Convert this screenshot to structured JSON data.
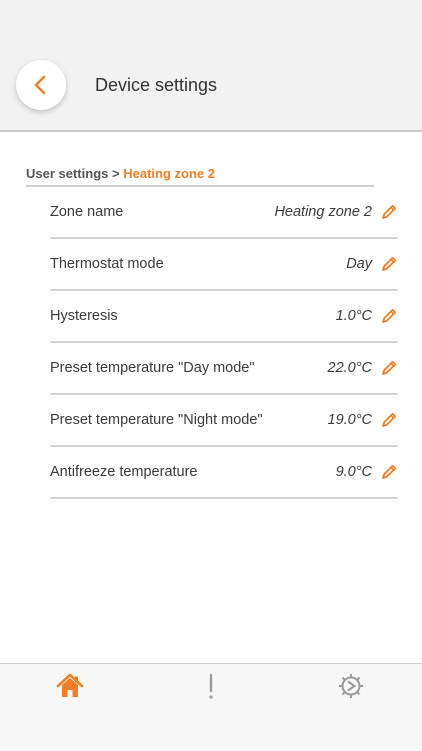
{
  "header": {
    "title": "Device settings",
    "back_icon": "chevron-left-icon"
  },
  "breadcrumb": {
    "parent": "User settings",
    "separator": ">",
    "current": "Heating zone 2"
  },
  "settings": [
    {
      "label": "Zone name",
      "value": "Heating zone 2"
    },
    {
      "label": "Thermostat mode",
      "value": "Day"
    },
    {
      "label": "Hysteresis",
      "value": "1.0°C"
    },
    {
      "label": "Preset temperature \"Day mode\"",
      "value": "22.0°C"
    },
    {
      "label": "Preset temperature \"Night mode\"",
      "value": "19.0°C"
    },
    {
      "label": "Antifreeze temperature",
      "value": "9.0°C"
    }
  ],
  "tabbar": {
    "tabs": [
      {
        "icon": "home-icon",
        "active": true
      },
      {
        "icon": "exclamation-icon",
        "active": false
      },
      {
        "icon": "gear-icon",
        "active": false
      }
    ]
  },
  "colors": {
    "accent": "#ee7f26",
    "header_bg": "#f2f2f2",
    "divider": "#d2d2d2",
    "inactive_icon": "#9a9a9a"
  }
}
